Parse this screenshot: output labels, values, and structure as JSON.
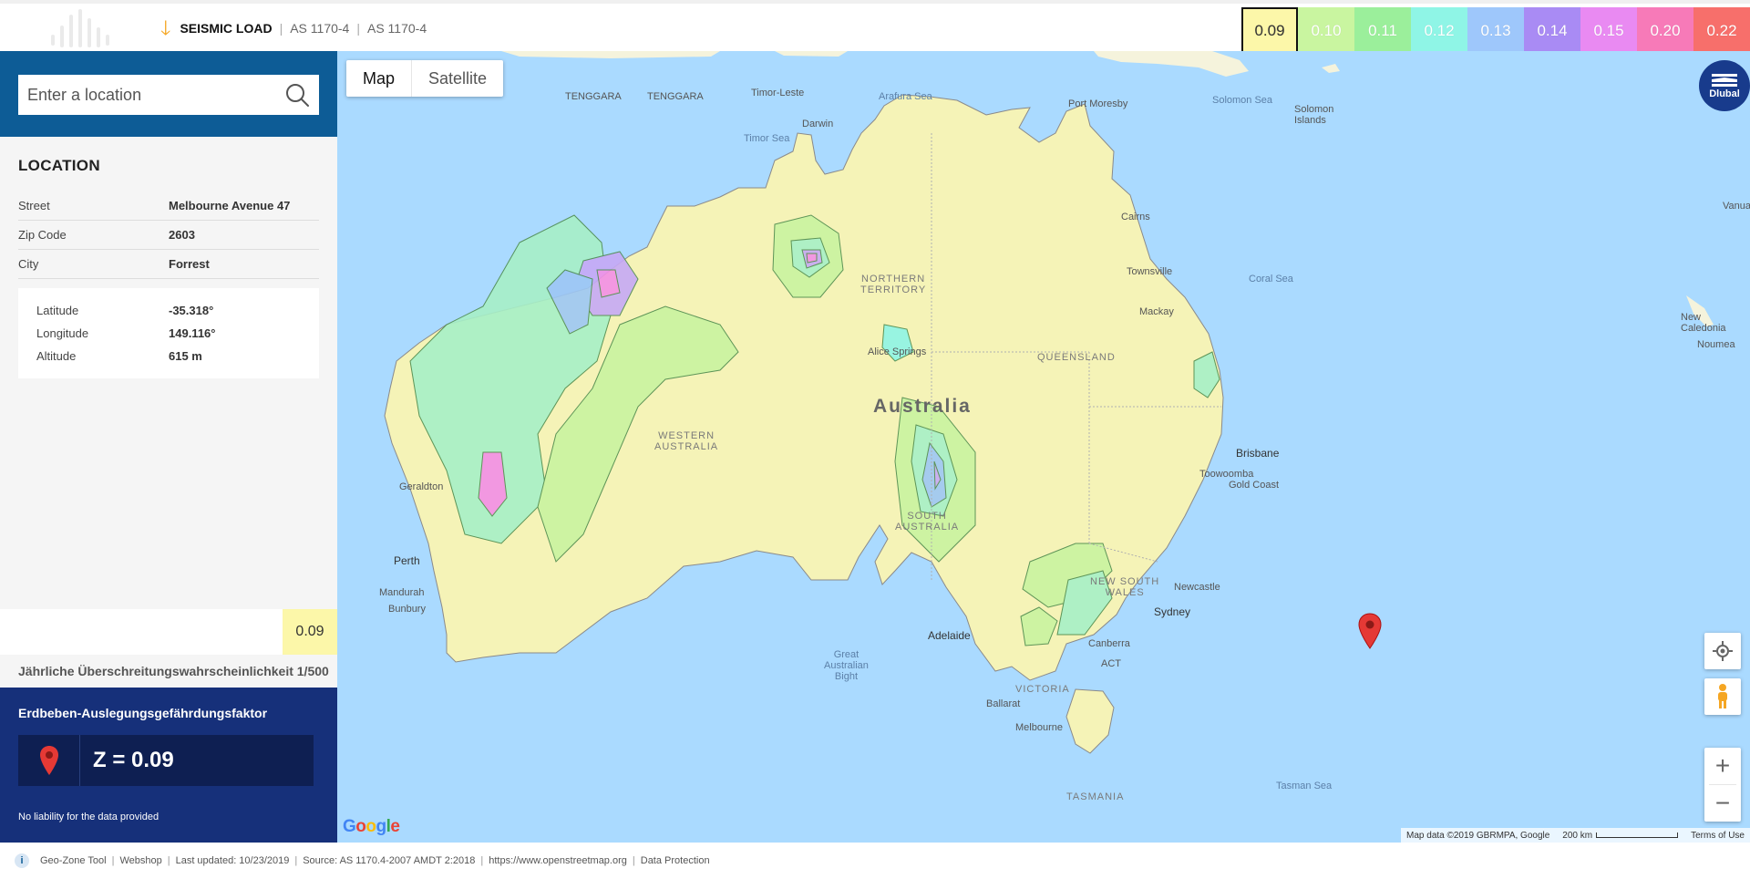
{
  "header": {
    "title": "SEISMIC LOAD",
    "standard_1": "AS 1170-4",
    "standard_2": "AS 1170-4"
  },
  "legend": [
    {
      "value": "0.09",
      "color": "#fcf7a9",
      "active": true
    },
    {
      "value": "0.10",
      "color": "#c9f5a0"
    },
    {
      "value": "0.11",
      "color": "#9bef9b"
    },
    {
      "value": "0.12",
      "color": "#8ff5e6"
    },
    {
      "value": "0.13",
      "color": "#9ec7fb"
    },
    {
      "value": "0.14",
      "color": "#a98bf4"
    },
    {
      "value": "0.15",
      "color": "#e98af2"
    },
    {
      "value": "0.20",
      "color": "#f77ab8"
    },
    {
      "value": "0.22",
      "color": "#f76f6b"
    }
  ],
  "search": {
    "placeholder": "Enter a location"
  },
  "location": {
    "heading": "LOCATION",
    "street_label": "Street",
    "street": "Melbourne Avenue 47",
    "zip_label": "Zip Code",
    "zip": "2603",
    "city_label": "City",
    "city": "Forrest",
    "latitude_label": "Latitude",
    "latitude": "-35.318°",
    "longitude_label": "Longitude",
    "longitude": "149.116°",
    "altitude_label": "Altitude",
    "altitude": "615 m"
  },
  "zone": {
    "value": "0.09",
    "probability": "Jährliche Überschreitungswahrscheinlichkeit 1/500",
    "result_title": "Erdbeben-Auslegungsgefährdungsfaktor",
    "result": "Z = 0.09",
    "liability": "No liability for the data provided"
  },
  "map": {
    "type_map": "Map",
    "type_satellite": "Satellite",
    "country": "Australia",
    "labels": {
      "tenggara_1": "TENGGARA",
      "tenggara_2": "TENGGARA",
      "timor_leste": "Timor-Leste",
      "arafura_sea": "Arafura Sea",
      "port_moresby": "Port Moresby",
      "solomon_sea": "Solomon Sea",
      "solomon_islands": "Solomon\nIslands",
      "timor_sea": "Timor Sea",
      "darwin": "Darwin",
      "cairns": "Cairns",
      "townsville": "Townsville",
      "mackay": "Mackay",
      "coral_sea": "Coral Sea",
      "vanuatu": "Vanua",
      "new_caledonia": "New\nCaledonia",
      "noumea": "Noumea",
      "northern_territory": "NORTHERN\nTERRITORY",
      "alice_springs": "Alice Springs",
      "queensland": "QUEENSLAND",
      "western_australia": "WESTERN\nAUSTRALIA",
      "brisbane": "Brisbane",
      "toowoomba": "Toowoomba",
      "gold_coast": "Gold Coast",
      "geraldton": "Geraldton",
      "south_australia": "SOUTH\nAUSTRALIA",
      "new_south_wales": "NEW SOUTH\nWALES",
      "newcastle": "Newcastle",
      "perth": "Perth",
      "mandurah": "Mandurah",
      "bunbury": "Bunbury",
      "sydney": "Sydney",
      "canberra": "Canberra",
      "act": "ACT",
      "adelaide": "Adelaide",
      "great_australian_bight": "Great\nAustralian\nBight",
      "victoria": "VICTORIA",
      "ballarat": "Ballarat",
      "melbourne": "Melbourne",
      "tasmania": "TASMANIA",
      "tasman_sea": "Tasman Sea"
    },
    "badge": "Dlubal",
    "google": "Google",
    "attribution": "Map data ©2019 GBRMPA, Google",
    "scale": "200 km",
    "terms": "Terms of Use"
  },
  "footer": {
    "tool": "Geo-Zone Tool",
    "webshop": "Webshop",
    "updated": "Last updated: 10/23/2019",
    "source": "Source: AS 1170.4-2007 AMDT 2:2018",
    "osm": "https://www.openstreetmap.org",
    "privacy": "Data Protection"
  }
}
